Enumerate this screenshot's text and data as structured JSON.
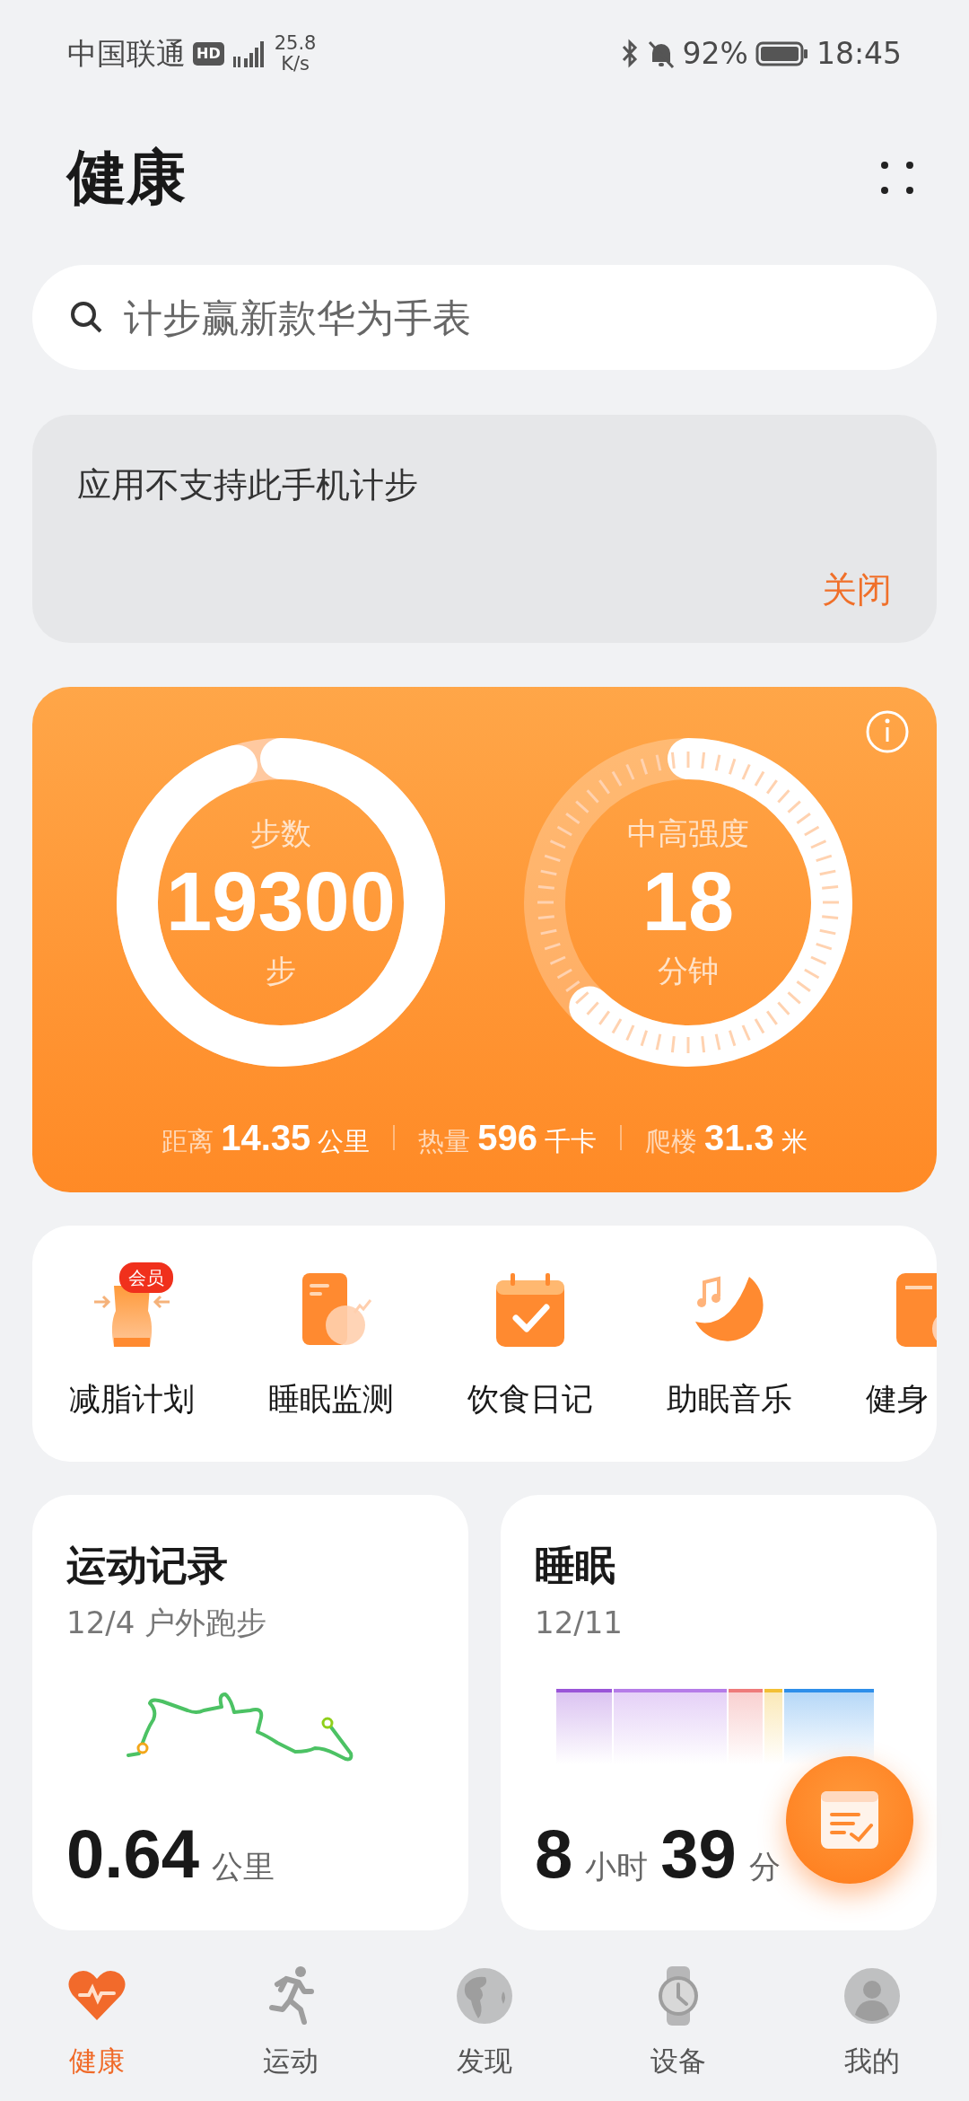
{
  "status_bar": {
    "carrier": "中国联通",
    "network_badge": "HD",
    "speed_value": "25.8",
    "speed_unit": "K/s",
    "battery": "92%",
    "time": "18:45"
  },
  "title": "健康",
  "search": {
    "placeholder": "计步赢新款华为手表"
  },
  "notice": {
    "text": "应用不支持此手机计步",
    "action": "关闭"
  },
  "activity": {
    "rings": [
      {
        "kind": "solid",
        "label": "步数",
        "value": "19300",
        "unit": "步",
        "level": 0.95
      },
      {
        "kind": "ticks",
        "label": "中高强度",
        "value": "18",
        "unit": "分钟",
        "level": 0.62
      }
    ],
    "stats": [
      {
        "label": "距离",
        "value": "14.35",
        "unit": "公里"
      },
      {
        "label": "热量",
        "value": "596",
        "unit": "千卡"
      },
      {
        "label": "爬楼",
        "value": "31.3",
        "unit": "米"
      }
    ]
  },
  "shortcuts": [
    {
      "label": "减脂计划",
      "badge": "会员"
    },
    {
      "label": "睡眠监测"
    },
    {
      "label": "饮食日记"
    },
    {
      "label": "助眠音乐"
    },
    {
      "label": "健身"
    }
  ],
  "exercise_card": {
    "title": "运动记录",
    "subtitle": "12/4 户外跑步",
    "value": "0.64",
    "unit": "公里"
  },
  "sleep_card": {
    "title": "睡眠",
    "date": "12/11",
    "hours": "8",
    "hours_unit": "小时",
    "minutes": "39",
    "minutes_unit": "分"
  },
  "tabs": [
    {
      "label": "健康",
      "selected": true
    },
    {
      "label": "运动",
      "selected": false
    },
    {
      "label": "发现",
      "selected": false
    },
    {
      "label": "设备",
      "selected": false
    },
    {
      "label": "我的",
      "selected": false
    }
  ]
}
